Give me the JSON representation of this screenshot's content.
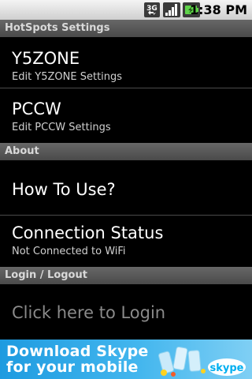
{
  "statusbar": {
    "network_badge": "3G",
    "time": "1:38 PM"
  },
  "sections": {
    "hotspots": {
      "header": "HotSpots Settings",
      "items": [
        {
          "title": "Y5ZONE",
          "subtitle": "Edit Y5ZONE Settings"
        },
        {
          "title": "PCCW",
          "subtitle": "Edit PCCW Settings"
        }
      ]
    },
    "about": {
      "header": "About",
      "items": [
        {
          "title": "How To Use?"
        },
        {
          "title": "Connection Status",
          "subtitle": "Not Connected to WiFi"
        }
      ]
    },
    "login": {
      "header": "Login / Logout",
      "items": [
        {
          "title": "Click here to Login"
        }
      ]
    }
  },
  "ad": {
    "line1": "Download Skype",
    "line2": "for your mobile",
    "brand": "skype",
    "brand_color": "#00aff0"
  },
  "colors": {
    "header_bg": "#555555",
    "background": "#000000",
    "disabled_text": "#8a8a8a"
  }
}
